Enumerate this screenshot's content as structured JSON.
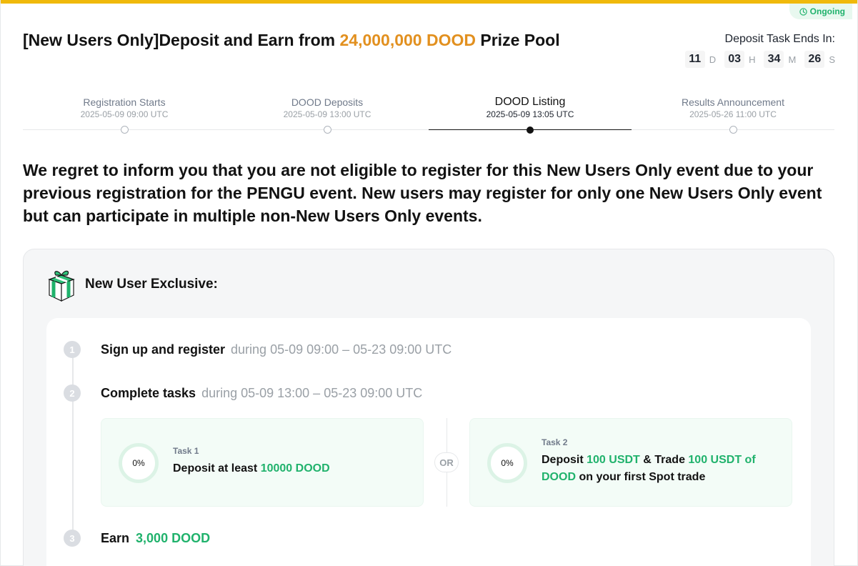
{
  "status": {
    "label": "Ongoing"
  },
  "title": {
    "prefix": "[New Users Only]Deposit and Earn from ",
    "highlight": "24,000,000 DOOD",
    "suffix": " Prize Pool"
  },
  "countdown": {
    "label": "Deposit Task Ends In:",
    "days": "11",
    "days_unit": "D",
    "hours": "03",
    "hours_unit": "H",
    "minutes": "34",
    "minutes_unit": "M",
    "seconds": "26",
    "seconds_unit": "S"
  },
  "timeline": [
    {
      "name": "Registration Starts",
      "date": "2025-05-09 09:00 UTC"
    },
    {
      "name": "DOOD  Deposits",
      "date": "2025-05-09 13:00 UTC"
    },
    {
      "name": "DOOD  Listing",
      "date": "2025-05-09 13:05 UTC"
    },
    {
      "name": "Results Announcement",
      "date": "2025-05-26 11:00 UTC"
    }
  ],
  "notice": "We regret to inform you that you are not eligible to register for this New Users Only event due to your previous registration for the PENGU event. New users may register for only one New Users Only event but can participate in multiple non-New Users Only events.",
  "card": {
    "title": "New User Exclusive:",
    "steps": [
      {
        "num": "1",
        "text": "Sign up and register",
        "sub": "during 05-09 09:00 – 05-23 09:00 UTC"
      },
      {
        "num": "2",
        "text": "Complete tasks",
        "sub": "during 05-09 13:00 – 05-23 09:00 UTC"
      },
      {
        "num": "3",
        "text": "Earn",
        "reward": "3,000 DOOD"
      }
    ],
    "tasks": [
      {
        "label": "Task 1",
        "progress": "0%",
        "desc_a": "Deposit at least ",
        "desc_b": "10000 DOOD"
      },
      {
        "label": "Task 2",
        "progress": "0%",
        "desc_a": "Deposit ",
        "desc_b": "100 USDT",
        "desc_c": " & Trade ",
        "desc_d": "100 USDT of DOOD",
        "desc_e": " on your first Spot trade"
      }
    ],
    "or_label": "OR"
  }
}
